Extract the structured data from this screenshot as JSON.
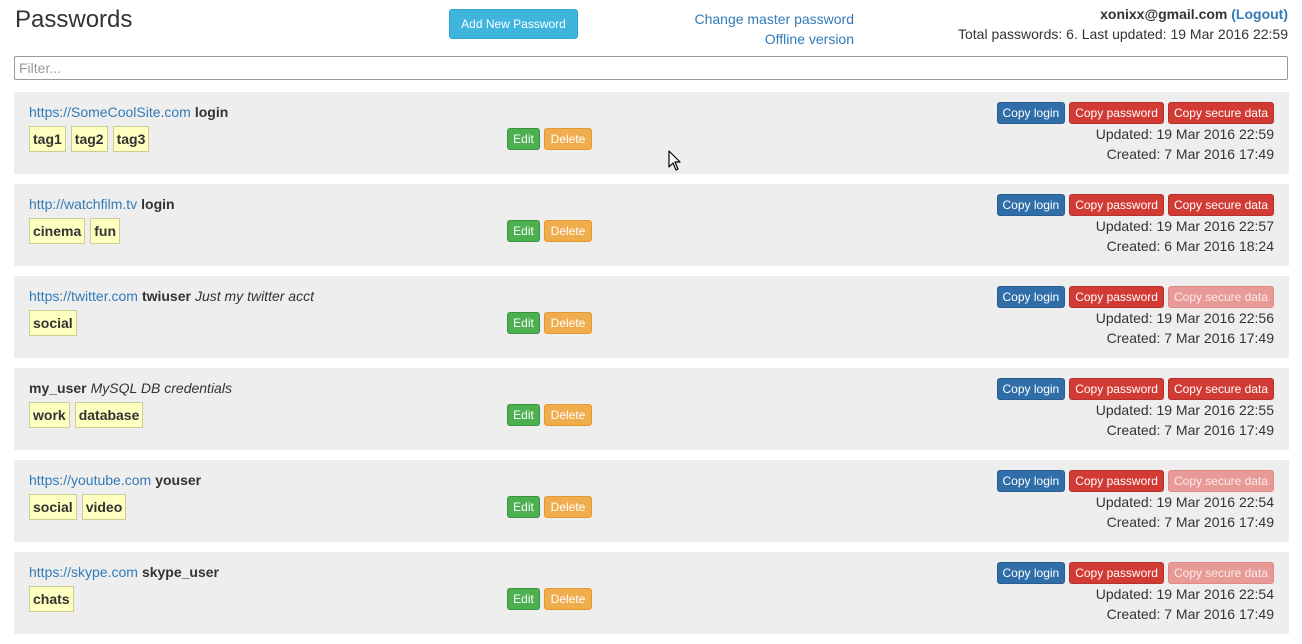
{
  "header": {
    "title": "Passwords",
    "add_button": "Add New Password",
    "change_master": "Change master password",
    "offline": "Offline version",
    "email": "xonixx@gmail.com",
    "logout": "(Logout)",
    "summary": "Total passwords: 6. Last updated: 19 Mar 2016 22:59"
  },
  "filter": {
    "placeholder": "Filter..."
  },
  "labels": {
    "edit": "Edit",
    "delete": "Delete",
    "copy_login": "Copy login",
    "copy_password": "Copy password",
    "copy_secure": "Copy secure data"
  },
  "rows": [
    {
      "site": "https://SomeCoolSite.com",
      "login": "login",
      "note": "",
      "tags": [
        "tag1",
        "tag2",
        "tag3"
      ],
      "secure_enabled": true,
      "updated": "Updated: 19 Mar 2016 22:59",
      "created": "Created: 7 Mar 2016 17:49"
    },
    {
      "site": "http://watchfilm.tv",
      "login": "login",
      "note": "",
      "tags": [
        "cinema",
        "fun"
      ],
      "secure_enabled": true,
      "updated": "Updated: 19 Mar 2016 22:57",
      "created": "Created: 6 Mar 2016 18:24"
    },
    {
      "site": "https://twitter.com",
      "login": "twiuser",
      "note": "Just my twitter acct",
      "tags": [
        "social"
      ],
      "secure_enabled": false,
      "updated": "Updated: 19 Mar 2016 22:56",
      "created": "Created: 7 Mar 2016 17:49"
    },
    {
      "site": "",
      "login": "my_user",
      "note": "MySQL DB credentials",
      "tags": [
        "work",
        "database"
      ],
      "secure_enabled": true,
      "updated": "Updated: 19 Mar 2016 22:55",
      "created": "Created: 7 Mar 2016 17:49"
    },
    {
      "site": "https://youtube.com",
      "login": "youser",
      "note": "",
      "tags": [
        "social",
        "video"
      ],
      "secure_enabled": false,
      "updated": "Updated: 19 Mar 2016 22:54",
      "created": "Created: 7 Mar 2016 17:49"
    },
    {
      "site": "https://skype.com",
      "login": "skype_user",
      "note": "",
      "tags": [
        "chats"
      ],
      "secure_enabled": false,
      "updated": "Updated: 19 Mar 2016 22:54",
      "created": "Created: 7 Mar 2016 17:49"
    }
  ]
}
